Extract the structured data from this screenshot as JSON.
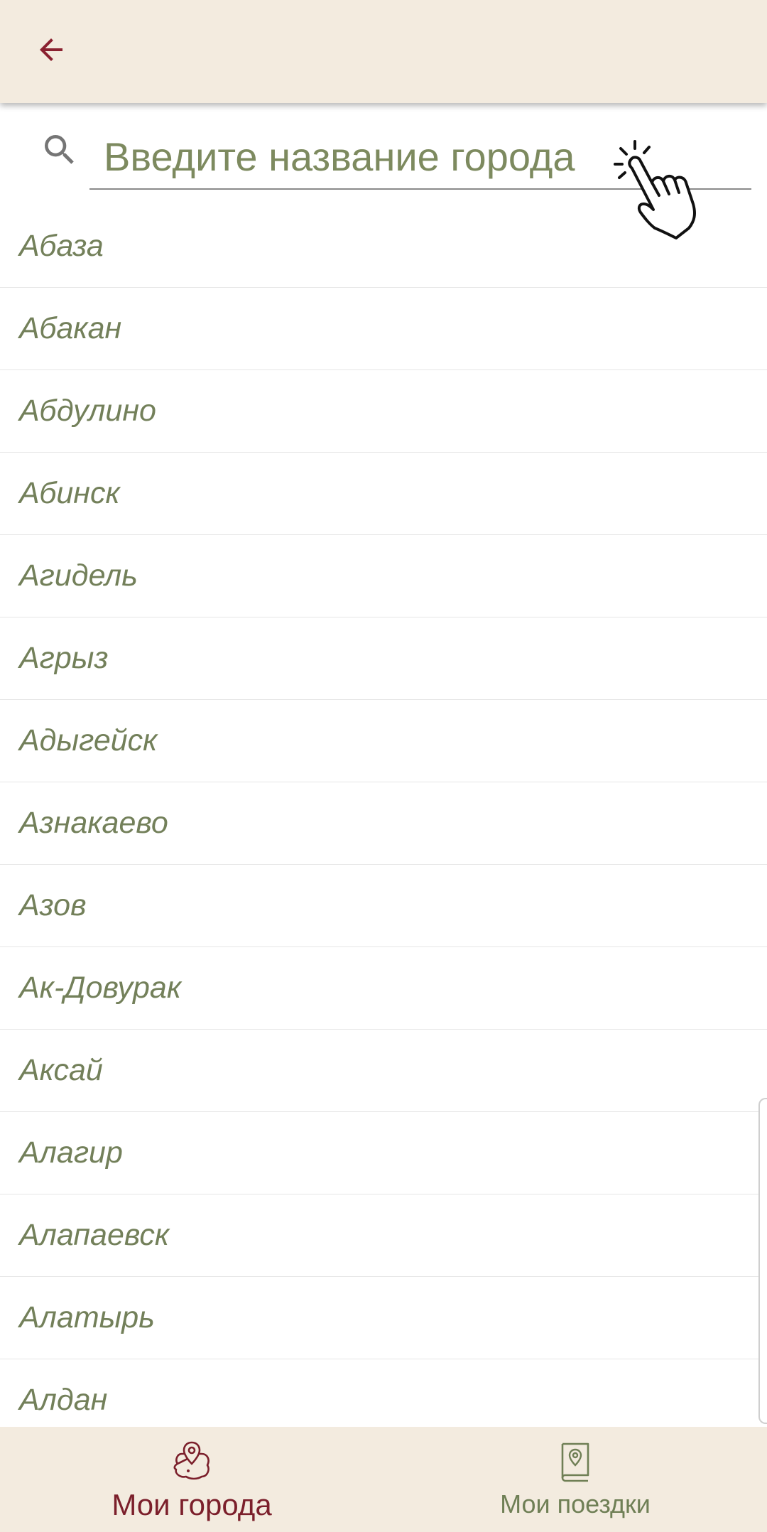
{
  "appbar": {
    "back_icon": "arrow-left-icon",
    "accent_color": "#7b1f2b",
    "background": "#f3ebdf"
  },
  "search": {
    "placeholder": "Введите название города",
    "value": "",
    "icon": "search-icon",
    "hint_icon": "tap-hand-icon"
  },
  "cities": [
    "Абаза",
    "Абакан",
    "Абдулино",
    "Абинск",
    "Агидель",
    "Агрыз",
    "Адыгейск",
    "Азнакаево",
    "Азов",
    "Ак-Довурак",
    "Аксай",
    "Алагир",
    "Алапаевск",
    "Алатырь",
    "Алдан"
  ],
  "bottom_nav": {
    "items": [
      {
        "label": "Мои города",
        "icon": "map-pin-region-icon",
        "active": true
      },
      {
        "label": "Мои поездки",
        "icon": "travel-book-icon",
        "active": false
      }
    ],
    "active_color": "#7b1f2b",
    "inactive_color": "#6f7f55"
  }
}
